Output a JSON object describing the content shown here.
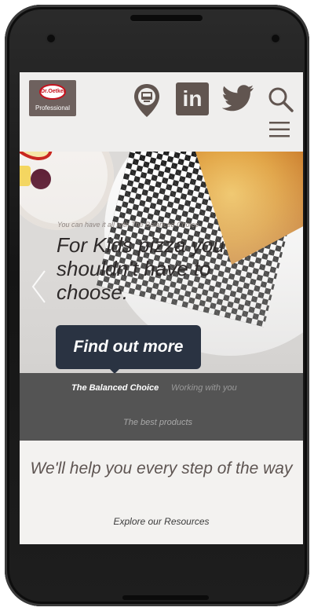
{
  "brand": {
    "logo_name": "Dr.Oetker",
    "logo_sub": "Professional",
    "accent": "#c5121d",
    "header_icon_color": "#615550"
  },
  "header": {
    "icons": [
      "location-pin-icon",
      "linkedin-icon",
      "twitter-icon",
      "search-icon",
      "menu-icon"
    ],
    "linkedin_label": "in"
  },
  "hero": {
    "kicker": "You can have it all with The Balanced Choice",
    "title": "For Kids pizza you shouldn’t have to choose.",
    "cta_label": "Find out more",
    "cta_color": "#2a3342"
  },
  "tabs": {
    "items": [
      {
        "label": "The Balanced Choice",
        "active": true
      },
      {
        "label": "Working with you",
        "active": false
      },
      {
        "label": "The best products",
        "active": false
      }
    ],
    "band_color": "#545454"
  },
  "help": {
    "title": "We'll help you every step of the way",
    "link": "Explore our Resources"
  }
}
